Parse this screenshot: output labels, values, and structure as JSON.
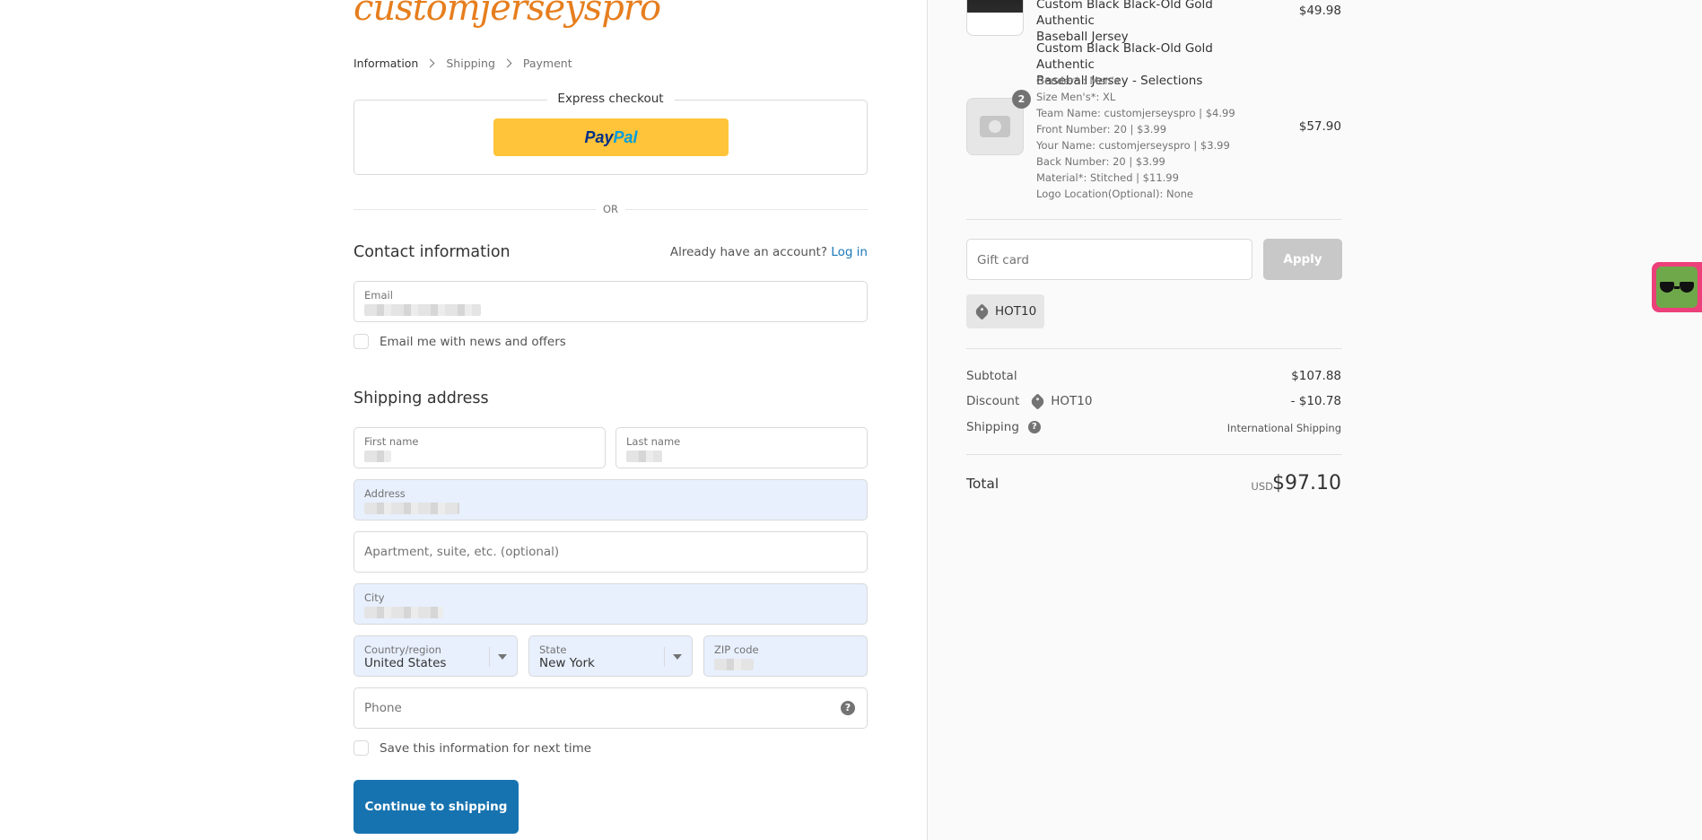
{
  "brand": {
    "logo_text": "customjerseyspro"
  },
  "breadcrumb": {
    "information": "Information",
    "shipping": "Shipping",
    "payment": "Payment"
  },
  "express": {
    "title": "Express checkout",
    "paypal_p": "Pay",
    "paypal_pal": "Pal",
    "or": "OR"
  },
  "contact": {
    "title": "Contact information",
    "account_prompt": "Already have an account?",
    "login": "Log in",
    "email_label": "Email",
    "newsletter_label": "Email me with news and offers"
  },
  "shipping_address": {
    "title": "Shipping address",
    "first_name_label": "First name",
    "last_name_label": "Last name",
    "address_label": "Address",
    "apartment_placeholder": "Apartment, suite, etc. (optional)",
    "city_label": "City",
    "country_label": "Country/region",
    "country_value": "United States",
    "state_label": "State",
    "state_value": "New York",
    "zip_label": "ZIP code",
    "phone_placeholder": "Phone",
    "save_info_label": "Save this information for next time"
  },
  "continue_label": "Continue to shipping",
  "cart": {
    "items": [
      {
        "title_line1": "Custom Black Black-Old Gold Authentic",
        "title_line2": "Baseball Jersey",
        "price": "$49.98"
      },
      {
        "title_line1": "Custom Black Black-Old Gold Authentic",
        "title_line2": "Baseball Jersey - Selections",
        "quantity": "2",
        "price": "$57.90",
        "options": [
          "Gender* : Men's",
          "Size Men's*: XL",
          "Team Name: customjerseyspro | $4.99",
          "Front Number: 20 | $3.99",
          "Your Name: customjerseyspro | $3.99",
          "Back Number: 20 | $3.99",
          "Material*: Stitched | $11.99",
          "Logo Location(Optional): None"
        ]
      }
    ],
    "gift_placeholder": "Gift card",
    "apply_label": "Apply",
    "discount_tag": "HOT10"
  },
  "summary": {
    "subtotal_label": "Subtotal",
    "subtotal_value": "$107.88",
    "discount_label": "Discount",
    "discount_code": "HOT10",
    "discount_value": "- $10.78",
    "shipping_label": "Shipping",
    "shipping_value": "International Shipping",
    "total_label": "Total",
    "currency": "USD",
    "total_value": "$97.10"
  },
  "colors": {
    "accent": "#1773b0",
    "paypal": "#ffc439",
    "logo": "#e67e1e",
    "autofill": "#e8f0fe"
  },
  "icons": {
    "extension": "sunglasses-icon",
    "help": "question-circle-icon",
    "tag": "tag-icon",
    "camera": "camera-icon"
  }
}
